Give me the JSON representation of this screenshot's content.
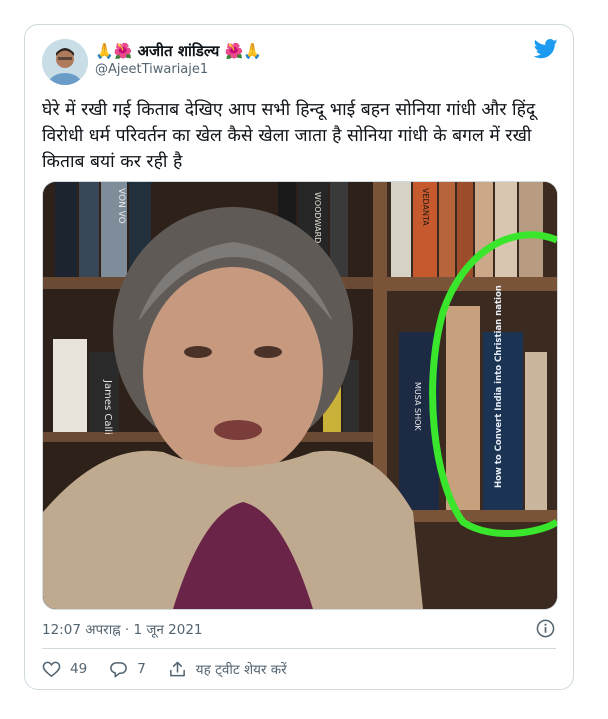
{
  "tweet": {
    "display_name": "🙏🌺 अजीत शांडिल्य 🌺🙏",
    "handle": "@AjeetTiwariaje1",
    "text": "घेरे में रखी गई किताब देखिए आप सभी हिन्दू भाई बहन सोनिया गांधी और हिंदू विरोधी धर्म परिवर्तन का खेल कैसे खेला जाता है सोनिया गांधी के बगल में रखी किताब बयां कर रही है",
    "timestamp": "12:07 अपराह्न · 1 जून 2021",
    "likes": "49",
    "replies": "7",
    "share_label": "यह ट्वीट शेयर करें"
  },
  "media": {
    "book_titles": {
      "convert": "How to Convert India into Christian nation",
      "james": "James Calli",
      "woodward": "WOODWARD",
      "musa": "MUSA SHOK",
      "vedanta": "VEDANTA",
      "von": "VON VO"
    }
  },
  "icons": {
    "brand": "twitter-bird-icon",
    "info": "info-icon",
    "like": "heart-icon",
    "reply": "reply-bubble-icon",
    "share": "share-upload-icon"
  },
  "colors": {
    "twitter_blue": "#1d9bf0",
    "text_primary": "#0f1419",
    "text_secondary": "#536471",
    "highlight_circle": "#39e62b"
  }
}
